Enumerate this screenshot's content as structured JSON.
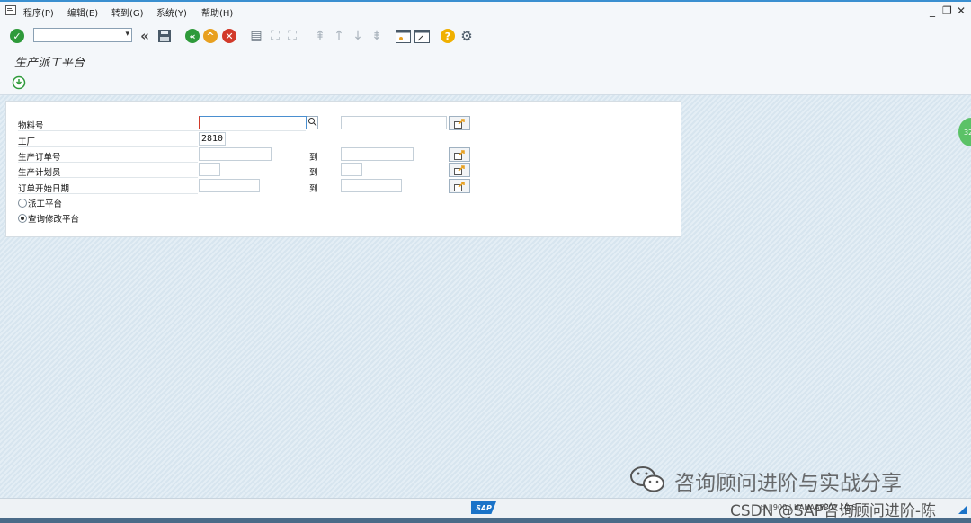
{
  "menu": {
    "items": [
      "程序(P)",
      "编辑(E)",
      "转到(G)",
      "系统(Y)",
      "帮助(H)"
    ],
    "window_controls": {
      "minimize": "_",
      "restore": "❐",
      "close": "✕"
    }
  },
  "toolbar": {
    "command_field": "",
    "icons": [
      "check-icon",
      "back-double-icon",
      "save-icon",
      "back-icon",
      "exit-icon",
      "cancel-icon",
      "print-icon",
      "find-icon",
      "find-next-icon",
      "first-page-icon",
      "prev-page-icon",
      "next-page-icon",
      "last-page-icon",
      "new-session-icon",
      "shortcut-icon",
      "help-icon",
      "settings-icon"
    ]
  },
  "title": "生产派工平台",
  "form": {
    "material": {
      "label": "物料号",
      "from": "",
      "to": ""
    },
    "plant": {
      "label": "工厂",
      "value": "2810"
    },
    "order": {
      "label": "生产订单号",
      "from": "",
      "to_label": "到",
      "to": ""
    },
    "planner": {
      "label": "生产计划员",
      "from": "",
      "to_label": "到",
      "to": ""
    },
    "start_date": {
      "label": "订单开始日期",
      "from": "",
      "to_label": "到",
      "to": ""
    },
    "radio_dispatch": {
      "label": "派工平台",
      "selected": false
    },
    "radio_query": {
      "label": "查询修改平台",
      "selected": true
    }
  },
  "side_badge": "32",
  "watermark": "咨询顾问进阶与实战分享",
  "status": {
    "sap_logo": "SAP",
    "info": "▷ | 900 | HANAAPP01 | INS"
  },
  "csdn_watermark": "CSDN @SAP咨询顾问进阶-陈",
  "colors": {
    "accent": "#3a8fd0",
    "ok_green": "#2e9a3a",
    "exit_orange": "#e8a020",
    "cancel_red": "#d23a2a"
  }
}
